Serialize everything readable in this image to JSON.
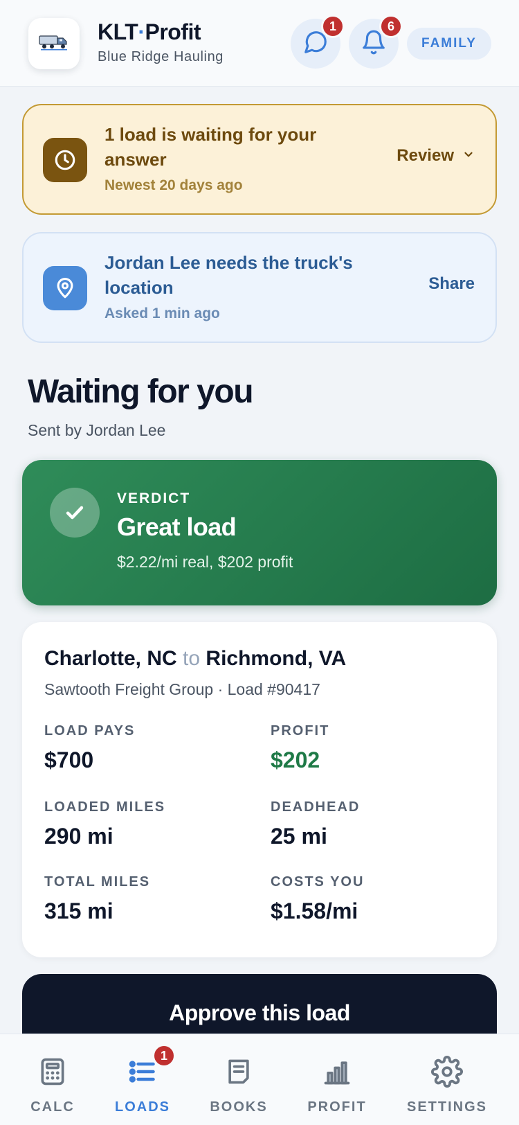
{
  "header": {
    "brand_name": "KLT",
    "brand_dot": "·",
    "brand_suffix": "Profit",
    "company": "Blue Ridge Hauling",
    "messages_count": "1",
    "notifications_count": "6",
    "mode_label": "FAMILY"
  },
  "alerts": {
    "answer": {
      "icon": "clock-icon",
      "title": "1 load is waiting for your answer",
      "subtitle": "Newest 20 days ago",
      "action": "Review"
    },
    "location": {
      "icon": "location-pin-icon",
      "title": "Jordan Lee needs the truck's location",
      "subtitle": "Asked 1 min ago",
      "action": "Share"
    }
  },
  "section": {
    "title": "Waiting for you",
    "subtitle": "Sent by Jordan Lee"
  },
  "verdict": {
    "label": "VERDICT",
    "title": "Great load",
    "detail": "$2.22/mi real, $202 profit"
  },
  "load": {
    "origin": "Charlotte, NC",
    "connector": "to",
    "destination": "Richmond, VA",
    "meta": "Sawtooth Freight Group · Load #90417",
    "stats": [
      {
        "label": "LOAD PAYS",
        "value": "$700"
      },
      {
        "label": "PROFIT",
        "value": "$202"
      },
      {
        "label": "LOADED MILES",
        "value": "290 mi"
      },
      {
        "label": "DEADHEAD",
        "value": "25 mi"
      },
      {
        "label": "TOTAL MILES",
        "value": "315 mi"
      },
      {
        "label": "COSTS YOU",
        "value": "$1.58/mi"
      }
    ]
  },
  "approve_label": "Approve this load",
  "nav": {
    "items": [
      {
        "label": "CALC",
        "icon": "calculator-icon"
      },
      {
        "label": "LOADS",
        "icon": "list-icon",
        "badge": "1"
      },
      {
        "label": "BOOKS",
        "icon": "notebook-icon"
      },
      {
        "label": "PROFIT",
        "icon": "bar-chart-icon"
      },
      {
        "label": "SETTINGS",
        "icon": "gear-icon"
      }
    ]
  },
  "colors": {
    "accent": "#3b7dd8",
    "badge": "#c0302f",
    "verdict_green": "#2f8c59",
    "profit_green": "#1f7a47",
    "warning_bg": "#fcf1d8"
  }
}
